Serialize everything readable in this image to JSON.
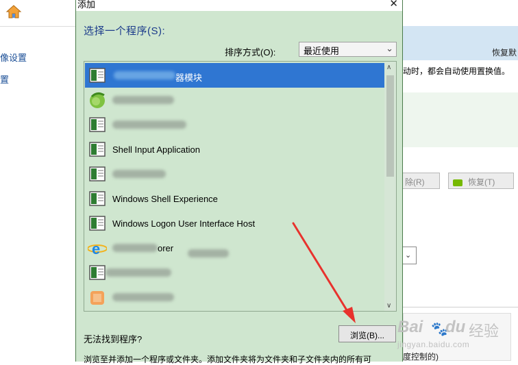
{
  "background": {
    "left_nav": [
      "像设置",
      "置"
    ],
    "restore_default": "恢复默",
    "description": "动时，都会自动使用置换值。",
    "delete_button": "除(R)",
    "restore_button": "恢复(T)",
    "footer_fragment": "度控制的)"
  },
  "dialog": {
    "title": "添加",
    "close_glyph": "✕",
    "heading": "选择一个程序(S):",
    "sort_label": "排序方式(O):",
    "sort_value": "最近使用",
    "programs": [
      {
        "label": "器模块",
        "icon": "app-window-icon",
        "selected": true
      },
      {
        "label": "",
        "icon": "green-globe-icon"
      },
      {
        "label": "",
        "icon": "app-window-icon"
      },
      {
        "label": "Shell Input Application",
        "icon": "app-window-icon"
      },
      {
        "label": "",
        "icon": "app-window-icon"
      },
      {
        "label": "Windows Shell Experience",
        "icon": "app-window-icon"
      },
      {
        "label": "Windows Logon User Interface Host",
        "icon": "app-window-icon"
      },
      {
        "label": "orer",
        "icon": "internet-explorer-icon"
      },
      {
        "label": "",
        "icon": "app-window-icon"
      },
      {
        "label": "",
        "icon": "orange-app-icon"
      }
    ],
    "not_found": "无法找到程序?",
    "browse_button": "浏览(B)...",
    "bottom_text": "浏览至并添加一个程序或文件夹。添加文件夹将为文件夹和子文件夹内的所有可"
  },
  "watermark": {
    "logo": "Bai",
    "logo_suffix": "du",
    "brand": "经验",
    "url": "jingyan.baidu.com"
  },
  "colors": {
    "dialog_bg": "#cfe6cf",
    "selection": "#2f76d2",
    "arrow": "#e8322d"
  }
}
